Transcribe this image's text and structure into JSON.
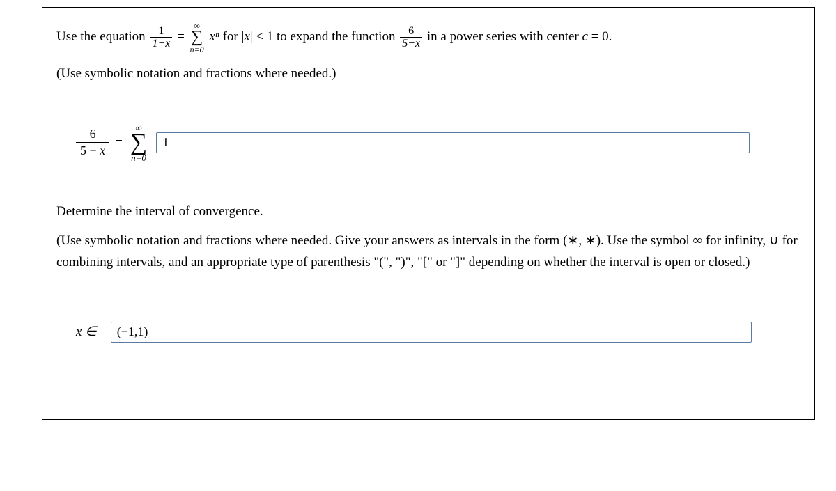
{
  "problem": {
    "prompt_pre": "Use the equation ",
    "frac1_num": "1",
    "frac1_den": "1−x",
    "eq": " = ",
    "sum_top": "∞",
    "sum_bot": "n=0",
    "sum_body": " xⁿ ",
    "cond": "for |x| < 1 to expand the function ",
    "frac2_num": "6",
    "frac2_den": "5−x",
    "prompt_post": " in a power series with center c = 0.",
    "hint": "(Use symbolic notation and fractions where needed.)"
  },
  "answer1": {
    "lhs_num": "6",
    "lhs_den": "5 − x",
    "eq": "=",
    "sum_top": "∞",
    "sum_bot": "n=0",
    "value": "1"
  },
  "section2": {
    "title": "Determine the interval of convergence.",
    "hint": "(Use symbolic notation and fractions where needed. Give your answers as intervals in the form (∗, ∗). Use the symbol ∞ for infinity, ∪ for combining intervals, and an appropriate type of parenthesis \"(\", \")\", \"[\" or \"]\" depending on whether the interval is open or closed.)"
  },
  "answer2": {
    "lhs": "x ∈",
    "value": "(−1,1)"
  }
}
